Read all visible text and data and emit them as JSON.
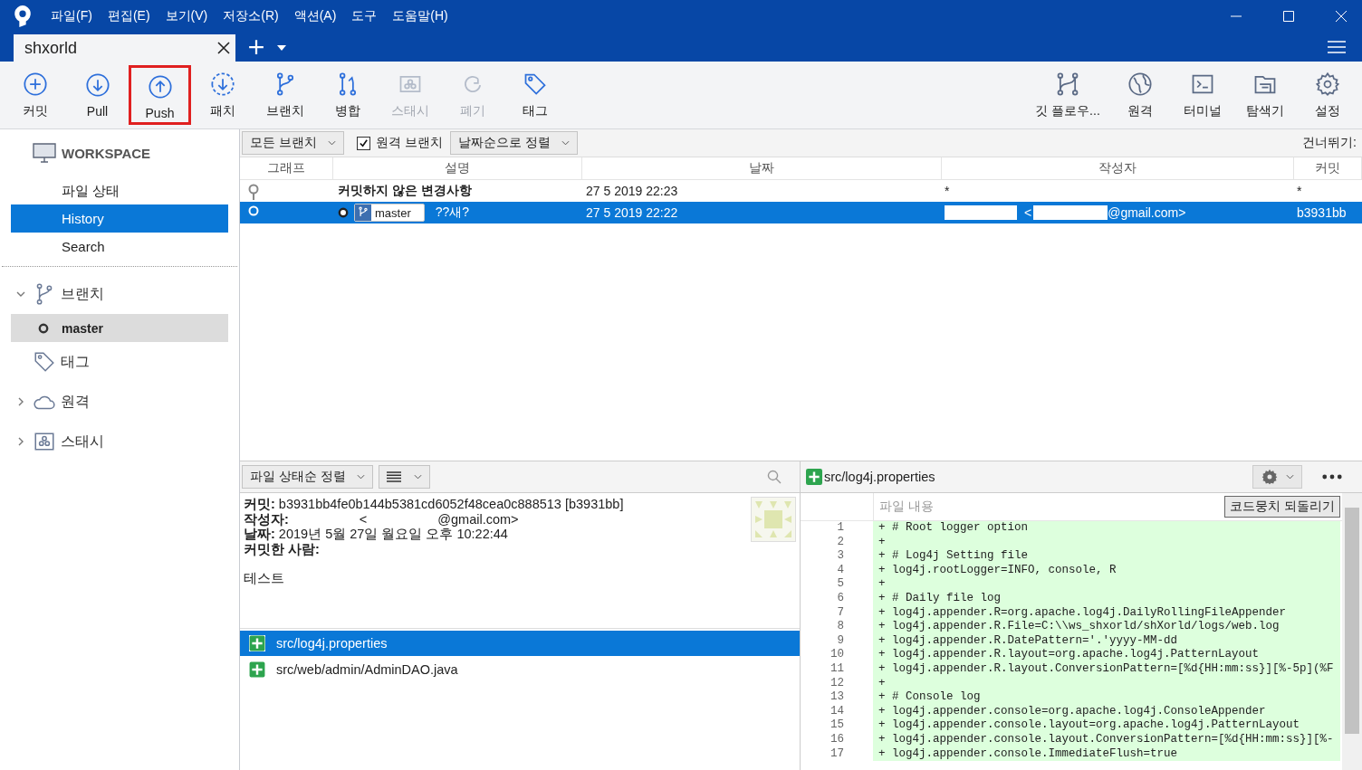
{
  "menu": [
    "파일(F)",
    "편집(E)",
    "보기(V)",
    "저장소(R)",
    "액션(A)",
    "도구",
    "도움말(H)"
  ],
  "tabs": [
    {
      "label": "shxorld",
      "selected": true
    }
  ],
  "toolbar": {
    "left": [
      {
        "label": "커밋",
        "disabled": false,
        "highlighted": false
      },
      {
        "label": "Pull",
        "disabled": false,
        "highlighted": false
      },
      {
        "label": "Push",
        "disabled": false,
        "highlighted": true
      },
      {
        "label": "패치",
        "disabled": false,
        "highlighted": false
      },
      {
        "label": "브랜치",
        "disabled": false,
        "highlighted": false
      },
      {
        "label": "병합",
        "disabled": false,
        "highlighted": false
      },
      {
        "label": "스태시",
        "disabled": true,
        "highlighted": false
      },
      {
        "label": "폐기",
        "disabled": true,
        "highlighted": false
      },
      {
        "label": "태그",
        "disabled": false,
        "highlighted": false
      }
    ],
    "right": [
      {
        "label": "깃 플로우..."
      },
      {
        "label": "원격"
      },
      {
        "label": "터미널"
      },
      {
        "label": "탐색기"
      },
      {
        "label": "설정"
      }
    ]
  },
  "sidebar": {
    "workspace": "WORKSPACE",
    "items": [
      {
        "label": "파일 상태",
        "selected": false
      },
      {
        "label": "History",
        "selected": true
      },
      {
        "label": "Search",
        "selected": false
      }
    ],
    "tree": [
      {
        "label": "브랜치",
        "expanded": true,
        "children": [
          {
            "label": "master",
            "selected": true
          }
        ]
      },
      {
        "label": "태그"
      },
      {
        "label": "원격",
        "expanded": false
      },
      {
        "label": "스태시",
        "expanded": false
      }
    ]
  },
  "filters": {
    "branches": "모든 브랜치",
    "remote_branches": {
      "label": "원격 브랜치",
      "checked": true
    },
    "sort": "날짜순으로 정렬",
    "jump": "건너뛰기:"
  },
  "commits": {
    "columns": [
      "그래프",
      "설명",
      "날짜",
      "작성자",
      "커밋"
    ],
    "rows": [
      {
        "kind": "uncommitted",
        "description": "커밋하지 않은 변경사항",
        "date": "27 5 2019 22:23",
        "author": "*",
        "commit": "*",
        "selected": false
      },
      {
        "kind": "commit",
        "branch": "master",
        "description": "??새?",
        "date": "27 5 2019 22:22",
        "author": "<",
        "author_email": "@gmail.com>",
        "commit": "b3931bb",
        "selected": true
      }
    ]
  },
  "details": {
    "sort": "파일 상태순 정렬",
    "fields": [
      {
        "label": "커밋:",
        "value": "b3931bb4fe0b144b5381cd6052f48cea0c888513 [b3931bb]"
      },
      {
        "label": "작성자:",
        "value": "<",
        "value_2": "@gmail.com>"
      },
      {
        "label": "날짜:",
        "value": "2019년 5월 27일 월요일 오후 10:22:44"
      },
      {
        "label": "커밋한 사람:"
      }
    ],
    "message": "테스트",
    "files": [
      {
        "path": "src/log4j.properties",
        "selected": true
      },
      {
        "path": "src/web/admin/AdminDAO.java",
        "selected": false
      }
    ]
  },
  "diff": {
    "file": "src/log4j.properties",
    "section": "파일 내용",
    "revert": "코드뭉치 되돌리기",
    "lines": [
      {
        "number": "1",
        "text": "+ # Root logger option"
      },
      {
        "number": "2",
        "text": "+"
      },
      {
        "number": "3",
        "text": "+ # Log4j Setting file"
      },
      {
        "number": "4",
        "text": "+ log4j.rootLogger=INFO, console, R"
      },
      {
        "number": "5",
        "text": "+"
      },
      {
        "number": "6",
        "text": "+ # Daily file log"
      },
      {
        "number": "7",
        "text": "+ log4j.appender.R=org.apache.log4j.DailyRollingFileAppender"
      },
      {
        "number": "8",
        "text": "+ log4j.appender.R.File=C:\\\\ws_shxorld/shXorld/logs/web.log"
      },
      {
        "number": "9",
        "text": "+ log4j.appender.R.DatePattern='.'yyyy-MM-dd"
      },
      {
        "number": "10",
        "text": "+ log4j.appender.R.layout=org.apache.log4j.PatternLayout"
      },
      {
        "number": "11",
        "text": "+ log4j.appender.R.layout.ConversionPattern=[%d{HH:mm:ss}][%-5p](%F"
      },
      {
        "number": "12",
        "text": "+"
      },
      {
        "number": "13",
        "text": "+ # Console log"
      },
      {
        "number": "14",
        "text": "+ log4j.appender.console=org.apache.log4j.ConsoleAppender"
      },
      {
        "number": "15",
        "text": "+ log4j.appender.console.layout=org.apache.log4j.PatternLayout"
      },
      {
        "number": "16",
        "text": "+ log4j.appender.console.layout.ConversionPattern=[%d{HH:mm:ss}][%-"
      },
      {
        "number": "17",
        "text": "+ log4j.appender.console.ImmediateFlush=true"
      }
    ]
  }
}
